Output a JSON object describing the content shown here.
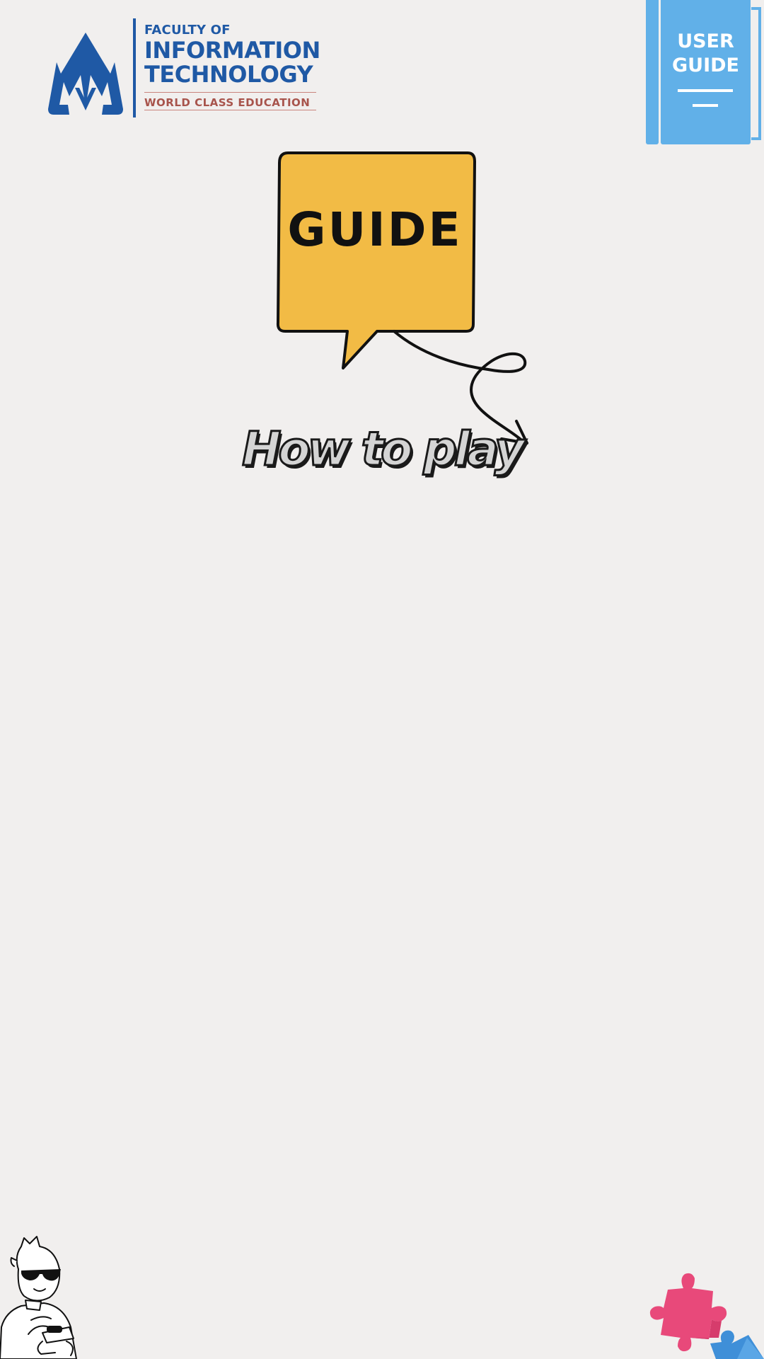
{
  "logo": {
    "line1": "FACULTY OF",
    "line2": "INFORMATION",
    "line3": "TECHNOLOGY",
    "line4": "WORLD CLASS EDUCATION",
    "brand_color": "#1f59a5",
    "accent_color": "#a8544c"
  },
  "user_guide": {
    "label": "USER\nGUIDE",
    "color": "#61b0e8"
  },
  "bubble": {
    "label": "GUIDE",
    "color": "#f2bb45"
  },
  "how_to_play": {
    "label": "How to play"
  },
  "decorations": {
    "gamer": "gamer-with-sunglasses-illustration",
    "puzzle": "puzzle-pieces-illustration",
    "puzzle_colors": [
      "#e8497a",
      "#3f8fd8"
    ]
  },
  "background_color": "#f1efee"
}
